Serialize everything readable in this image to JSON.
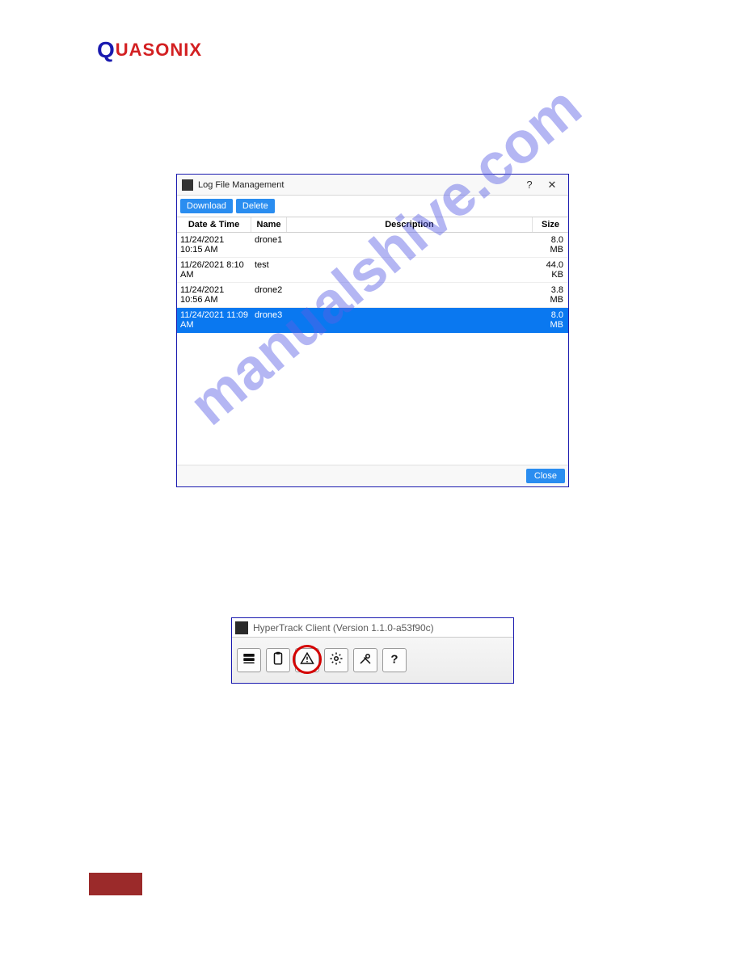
{
  "logo": {
    "first": "Q",
    "rest": "UASONIX"
  },
  "watermark": "manualshive.com",
  "log_dialog": {
    "title": "Log File Management",
    "help_symbol": "?",
    "close_symbol": "✕",
    "buttons": {
      "download": "Download",
      "delete": "Delete",
      "close": "Close"
    },
    "columns": {
      "datetime": "Date & Time",
      "name": "Name",
      "description": "Description",
      "size": "Size"
    },
    "rows": [
      {
        "datetime": "11/24/2021 10:15 AM",
        "name": "drone1",
        "description": "",
        "size": "8.0 MB",
        "selected": false
      },
      {
        "datetime": "11/26/2021 8:10 AM",
        "name": "test",
        "description": "",
        "size": "44.0 KB",
        "selected": false
      },
      {
        "datetime": "11/24/2021 10:56 AM",
        "name": "drone2",
        "description": "",
        "size": "3.8 MB",
        "selected": false
      },
      {
        "datetime": "11/24/2021 11:09 AM",
        "name": "drone3",
        "description": "",
        "size": "8.0 MB",
        "selected": true
      }
    ]
  },
  "toolbar_window": {
    "title": "HyperTrack Client (Version 1.1.0-a53f90c)",
    "buttons": [
      {
        "name": "server-icon"
      },
      {
        "name": "clipboard-icon"
      },
      {
        "name": "warning-icon",
        "circled": true
      },
      {
        "name": "gear-icon"
      },
      {
        "name": "tools-icon"
      },
      {
        "name": "help-icon"
      }
    ]
  }
}
